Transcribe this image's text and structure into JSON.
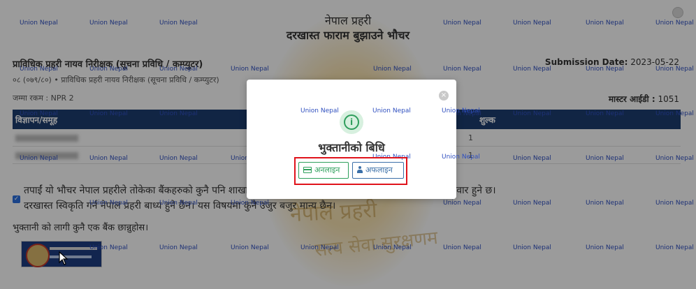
{
  "header": {
    "org": "नेपाल प्रहरी",
    "voucher_title": "दरखास्त फाराम बुझाउने भौचर"
  },
  "application": {
    "post_title": "प्राविधिक प्रहरी नायव निरीक्षक (सूचना प्रविधि / कम्प्युटर)",
    "submission_label": "Submission Date:",
    "submission_date": "2023-05-22",
    "sub_line": "०८ (०७९/८०) • प्राविधिक प्रहरी नायव निरीक्षक (सूचना प्रविधि / कम्प्युटर)",
    "fee_line": "जम्मा रकम : NPR 2",
    "master_label": "मास्टर आईडी :",
    "master_id": "1051"
  },
  "table": {
    "headers": [
      "विज्ञापन/समूह",
      "शुल्क"
    ],
    "rows": [
      {
        "fee": "1"
      },
      {
        "fee": "1"
      }
    ]
  },
  "notice": {
    "line1": "तपाईं यो भौचर नेपाल प्रहरीले तोकेका बैंकहरुको कुनै पनि शाखा मा … ती भन्दा पछाडी भुक्तानी गरेमा उमेद्धवार स्वयं जिम्मेवार हुने छ।",
    "line2": "दरखास्त स्विकृति गर्न नेपाल प्रहरी बाध्य हुने छैन। यस विषयमा कुनै उजुर बजुर मान्य छैन।",
    "checkbox_mark": "✓"
  },
  "choose_bank": "भुक्तानी को लागी कुनै एक बैंक छान्नुहोस।",
  "watermark": "Union Nepal",
  "emblem": {
    "text1": "नेपाल प्रहरी",
    "text2": "सत्य सेवा सुरक्षणम"
  },
  "modal": {
    "title": "भुक्तानीको बिधि",
    "info_glyph": "i",
    "close_glyph": "×",
    "online_label": "अनलाइन",
    "offline_label": "अफलाइन",
    "highlight_color": "#e0131b"
  },
  "colors": {
    "table_header": "#1c3c6e",
    "online": "#2fa05c",
    "offline": "#3b6fa8"
  }
}
